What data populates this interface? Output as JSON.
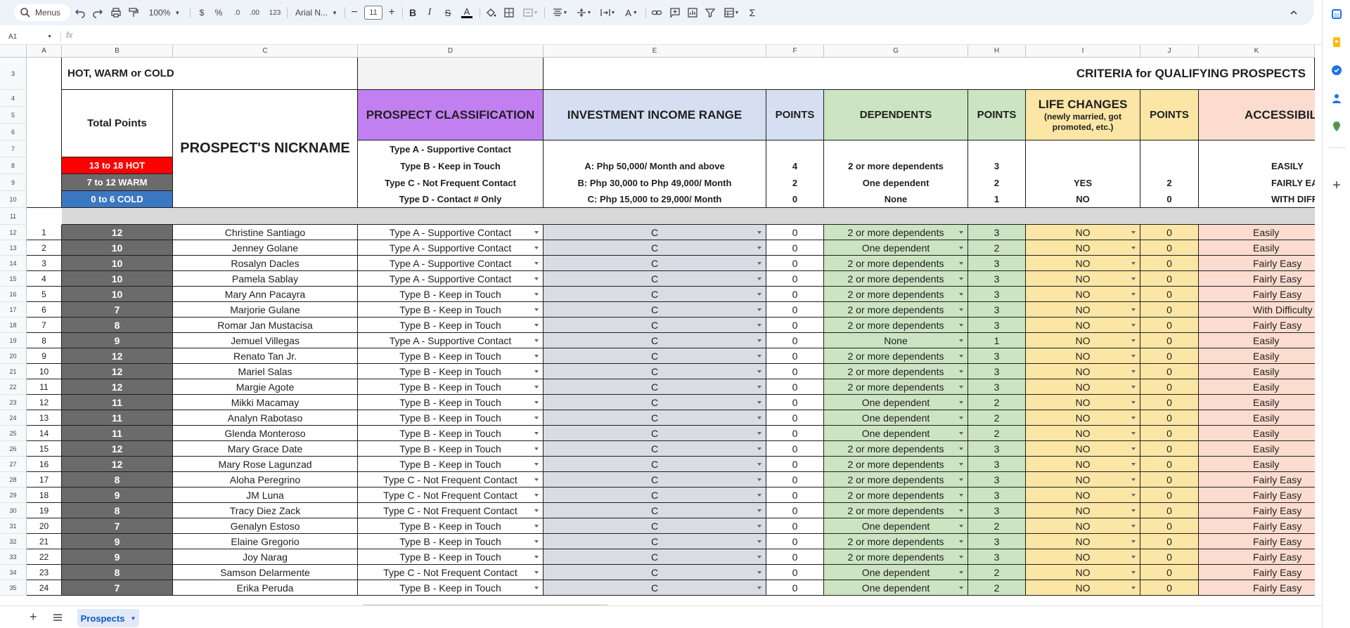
{
  "toolbar": {
    "menus_label": "Menus",
    "zoom": "100%",
    "currency": "$",
    "percent": "%",
    "dec_decrease": ".0",
    "dec_increase": ".00",
    "number_format": "123",
    "font": "Arial N...",
    "font_size": "11",
    "minus": "−",
    "plus": "+"
  },
  "formula_bar": {
    "name_box": "A1",
    "fx": "fx"
  },
  "columns": [
    "A",
    "B",
    "C",
    "D",
    "E",
    "F",
    "G",
    "H",
    "I",
    "J",
    "K"
  ],
  "header_rows": [
    "3",
    "4",
    "5",
    "6",
    "7",
    "8",
    "9",
    "10",
    "11"
  ],
  "header": {
    "hot_warm_cold": "HOT, WARM or COLD",
    "criteria_title": "CRITERIA for QUALIFYING PROSPECTS",
    "total_points": "Total Points",
    "prospect_nickname": "PROSPECT'S NICKNAME",
    "prospect_classification": "PROSPECT CLASSIFICATION",
    "investment_income_range": "INVESTMENT INCOME RANGE",
    "points": "POINTS",
    "dependents": "DEPENDENTS",
    "life_changes": "LIFE CHANGES",
    "life_changes_sub1": "(newly married, got",
    "life_changes_sub2": "promoted, etc.)",
    "accessibility": "ACCESSIBIL",
    "legend_hot": "13 to 18  HOT",
    "legend_warm": "7 to 12  WARM",
    "legend_cold": "0 to 6  COLD",
    "types": [
      "Type A - Supportive Contact",
      "Type B - Keep in Touch",
      "Type C - Not Frequent Contact",
      "Type D - Contact # Only"
    ],
    "income": [
      "A:  Php 50,000/ Month and above",
      "B:  Php 30,000 to Php 49,000/ Month",
      "C:  Php 15,000 to 29,000/ Month"
    ],
    "income_points": [
      "4",
      "2",
      "0"
    ],
    "dependents_list": [
      "2 or more dependents",
      "One dependent",
      "None"
    ],
    "dependents_points": [
      "3",
      "2",
      "1"
    ],
    "life_list": [
      "YES",
      "NO"
    ],
    "life_points": [
      "2",
      "0"
    ],
    "access_list": [
      "EASILY",
      "FAIRLY EASY",
      "WITH DIFFICUL"
    ]
  },
  "rows": [
    {
      "r": "12",
      "n": "1",
      "total": "12",
      "name": "Christine Santiago",
      "type": "Type A - Supportive Contact",
      "income": "C",
      "ip": "0",
      "dep": "2 or more dependents",
      "dp": "3",
      "life": "NO",
      "lp": "0",
      "access": "Easily"
    },
    {
      "r": "13",
      "n": "2",
      "total": "10",
      "name": "Jenney Golane",
      "type": "Type A - Supportive Contact",
      "income": "C",
      "ip": "0",
      "dep": "One dependent",
      "dp": "2",
      "life": "NO",
      "lp": "0",
      "access": "Easily"
    },
    {
      "r": "14",
      "n": "3",
      "total": "10",
      "name": "Rosalyn Dacles",
      "type": "Type A - Supportive Contact",
      "income": "C",
      "ip": "0",
      "dep": "2 or more dependents",
      "dp": "3",
      "life": "NO",
      "lp": "0",
      "access": "Fairly Easy"
    },
    {
      "r": "15",
      "n": "4",
      "total": "10",
      "name": "Pamela Sablay",
      "type": "Type A - Supportive Contact",
      "income": "C",
      "ip": "0",
      "dep": "2 or more dependents",
      "dp": "3",
      "life": "NO",
      "lp": "0",
      "access": "Fairly Easy"
    },
    {
      "r": "16",
      "n": "5",
      "total": "10",
      "name": "Mary Ann Pacayra",
      "type": "Type B - Keep in Touch",
      "income": "C",
      "ip": "0",
      "dep": "2 or more dependents",
      "dp": "3",
      "life": "NO",
      "lp": "0",
      "access": "Fairly Easy"
    },
    {
      "r": "17",
      "n": "6",
      "total": "7",
      "name": "Marjorie Gulane",
      "type": "Type B - Keep in Touch",
      "income": "C",
      "ip": "0",
      "dep": "2 or more dependents",
      "dp": "3",
      "life": "NO",
      "lp": "0",
      "access": "With Difficulty"
    },
    {
      "r": "18",
      "n": "7",
      "total": "8",
      "name": "Romar Jan Mustacisa",
      "type": "Type B - Keep in Touch",
      "income": "C",
      "ip": "0",
      "dep": "2 or more dependents",
      "dp": "3",
      "life": "NO",
      "lp": "0",
      "access": "Fairly Easy"
    },
    {
      "r": "19",
      "n": "8",
      "total": "9",
      "name": "Jemuel Villegas",
      "type": "Type A - Supportive Contact",
      "income": "C",
      "ip": "0",
      "dep": "None",
      "dp": "1",
      "life": "NO",
      "lp": "0",
      "access": "Easily"
    },
    {
      "r": "20",
      "n": "9",
      "total": "12",
      "name": "Renato Tan Jr.",
      "type": "Type B - Keep in Touch",
      "income": "C",
      "ip": "0",
      "dep": "2 or more dependents",
      "dp": "3",
      "life": "NO",
      "lp": "0",
      "access": "Easily"
    },
    {
      "r": "21",
      "n": "10",
      "total": "12",
      "name": "Mariel Salas",
      "type": "Type B - Keep in Touch",
      "income": "C",
      "ip": "0",
      "dep": "2 or more dependents",
      "dp": "3",
      "life": "NO",
      "lp": "0",
      "access": "Easily"
    },
    {
      "r": "22",
      "n": "11",
      "total": "12",
      "name": "Margie Agote",
      "type": "Type B - Keep in Touch",
      "income": "C",
      "ip": "0",
      "dep": "2 or more dependents",
      "dp": "3",
      "life": "NO",
      "lp": "0",
      "access": "Easily"
    },
    {
      "r": "23",
      "n": "12",
      "total": "11",
      "name": "Mikki Macamay",
      "type": "Type B - Keep in Touch",
      "income": "C",
      "ip": "0",
      "dep": "One dependent",
      "dp": "2",
      "life": "NO",
      "lp": "0",
      "access": "Easily"
    },
    {
      "r": "24",
      "n": "13",
      "total": "11",
      "name": "Analyn Rabotaso",
      "type": "Type B - Keep in Touch",
      "income": "C",
      "ip": "0",
      "dep": "One dependent",
      "dp": "2",
      "life": "NO",
      "lp": "0",
      "access": "Easily"
    },
    {
      "r": "25",
      "n": "14",
      "total": "11",
      "name": "Glenda Monteroso",
      "type": "Type B - Keep in Touch",
      "income": "C",
      "ip": "0",
      "dep": "One dependent",
      "dp": "2",
      "life": "NO",
      "lp": "0",
      "access": "Easily"
    },
    {
      "r": "26",
      "n": "15",
      "total": "12",
      "name": "Mary Grace Date",
      "type": "Type B - Keep in Touch",
      "income": "C",
      "ip": "0",
      "dep": "2 or more dependents",
      "dp": "3",
      "life": "NO",
      "lp": "0",
      "access": "Easily"
    },
    {
      "r": "27",
      "n": "16",
      "total": "12",
      "name": "Mary Rose Lagunzad",
      "type": "Type B - Keep in Touch",
      "income": "C",
      "ip": "0",
      "dep": "2 or more dependents",
      "dp": "3",
      "life": "NO",
      "lp": "0",
      "access": "Easily"
    },
    {
      "r": "28",
      "n": "17",
      "total": "8",
      "name": "Aloha Peregrino",
      "type": "Type C - Not Frequent Contact",
      "income": "C",
      "ip": "0",
      "dep": "2 or more dependents",
      "dp": "3",
      "life": "NO",
      "lp": "0",
      "access": "Fairly Easy"
    },
    {
      "r": "29",
      "n": "18",
      "total": "9",
      "name": "JM Luna",
      "type": "Type C - Not Frequent Contact",
      "income": "C",
      "ip": "0",
      "dep": "2 or more dependents",
      "dp": "3",
      "life": "NO",
      "lp": "0",
      "access": "Fairly Easy"
    },
    {
      "r": "30",
      "n": "19",
      "total": "8",
      "name": "Tracy Diez Zack",
      "type": "Type C - Not Frequent Contact",
      "income": "C",
      "ip": "0",
      "dep": "2 or more dependents",
      "dp": "3",
      "life": "NO",
      "lp": "0",
      "access": "Fairly Easy"
    },
    {
      "r": "31",
      "n": "20",
      "total": "7",
      "name": "Genalyn Estoso",
      "type": "Type B - Keep in Touch",
      "income": "C",
      "ip": "0",
      "dep": "One dependent",
      "dp": "2",
      "life": "NO",
      "lp": "0",
      "access": "Fairly Easy"
    },
    {
      "r": "32",
      "n": "21",
      "total": "9",
      "name": "Elaine Gregorio",
      "type": "Type B - Keep in Touch",
      "income": "C",
      "ip": "0",
      "dep": "2 or more dependents",
      "dp": "3",
      "life": "NO",
      "lp": "0",
      "access": "Fairly Easy"
    },
    {
      "r": "33",
      "n": "22",
      "total": "9",
      "name": "Joy Narag",
      "type": "Type B - Keep in Touch",
      "income": "C",
      "ip": "0",
      "dep": "2 or more dependents",
      "dp": "3",
      "life": "NO",
      "lp": "0",
      "access": "Fairly Easy"
    },
    {
      "r": "34",
      "n": "23",
      "total": "8",
      "name": "Samson Delarmente",
      "type": "Type C - Not Frequent Contact",
      "income": "C",
      "ip": "0",
      "dep": "One dependent",
      "dp": "2",
      "life": "NO",
      "lp": "0",
      "access": "Fairly Easy"
    },
    {
      "r": "35",
      "n": "24",
      "total": "7",
      "name": "Erika Peruda",
      "type": "Type B - Keep in Touch",
      "income": "C",
      "ip": "0",
      "dep": "One dependent",
      "dp": "2",
      "life": "NO",
      "lp": "0",
      "access": "Fairly Easy"
    }
  ],
  "sheet_tab": "Prospects",
  "colors": {
    "purple": "#c27ff0",
    "blue": "#d5dff1",
    "green": "#cce4c2",
    "yellow": "#fbe6a5",
    "peach": "#fbdccf",
    "gray_total": "#6b6b6b",
    "hot": "#ff0000",
    "warm": "#6b6b6b",
    "cold": "#3b78c2",
    "toolbar": "#eef2f9",
    "income_cell": "#d9dce3"
  }
}
